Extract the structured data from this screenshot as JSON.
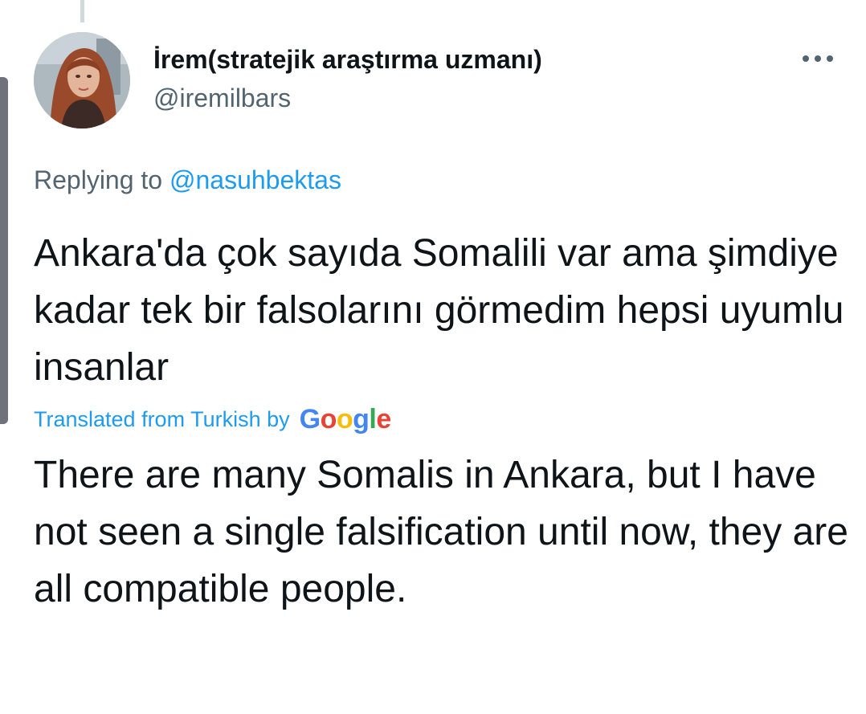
{
  "tweet": {
    "author": {
      "display_name": "İrem(stratejik araştırma uzmanı)",
      "handle": "@iremilbars"
    },
    "more_icon": "more-horizontal-icon",
    "replying_to": {
      "label": "Replying to",
      "mention": "@nasuhbektas"
    },
    "text": "Ankara'da çok sayıda Somalili var ama şimdiye kadar tek bir falsolarını görmedim hepsi uyumlu insanlar",
    "translation": {
      "label": "Translated from Turkish by",
      "provider_logo": {
        "letters": [
          "G",
          "o",
          "o",
          "g",
          "l",
          "e"
        ],
        "colors": [
          "#4285f4",
          "#ea4335",
          "#fbbc05",
          "#4285f4",
          "#34a853",
          "#ea4335"
        ]
      },
      "text": "There are many Somalis in Ankara, but I have not seen a single falsification until now, they are all compatible people."
    }
  },
  "colors": {
    "text_primary": "#0f1419",
    "text_secondary": "#536471",
    "accent": "#1d9bf0",
    "thread_line": "#cfd9de"
  }
}
